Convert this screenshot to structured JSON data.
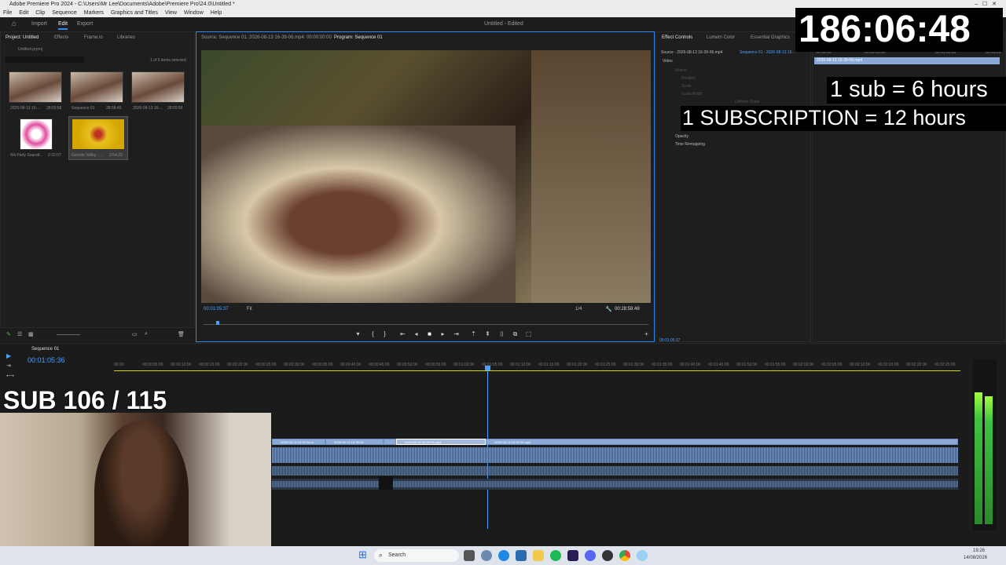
{
  "window": {
    "title": "Adobe Premiere Pro 2024 - C:\\Users\\Mr Lee\\Documents\\Adobe\\Premiere Pro\\24.0\\Untitled *"
  },
  "menu": [
    "File",
    "Edit",
    "Clip",
    "Sequence",
    "Markers",
    "Graphics and Titles",
    "View",
    "Window",
    "Help"
  ],
  "topnav": {
    "import": "Import",
    "edit": "Edit",
    "export": "Export",
    "project_name": "Untitled - Edited"
  },
  "project_panel": {
    "tabs": [
      "Project: Untitled",
      "Effects",
      "Frame.io",
      "Libraries"
    ],
    "file": "Untitled.prproj",
    "selection": "1 of 5 items selected",
    "items": [
      {
        "name": "2026-08-13 16-...",
        "duration": "28:59:58"
      },
      {
        "name": "Sequence 01",
        "duration": "28:58:49"
      },
      {
        "name": "2026-08-13 16-...",
        "duration": "28:59:58"
      },
      {
        "name": "Wii Party Soundt...",
        "duration": "2:32:07"
      },
      {
        "name": "Gerudo Valley - ...",
        "duration": "2:54:23"
      }
    ]
  },
  "monitor": {
    "source_tab": "Source: Sequence 01: 2026-08-13 16-39-06.mp4: 00:00:00:00",
    "program_tab": "Program: Sequence 01",
    "current_time": "00:01:05:37",
    "fit": "Fit",
    "quality": "1/4",
    "duration": "00:28:58:49"
  },
  "effect_controls": {
    "tabs": [
      "Effect Controls",
      "Lumetri Color",
      "Essential Graphics"
    ],
    "source": "Source - 2026-08-13 16-39-06.mp4",
    "sequence": "Sequence 01 - 2026-08-13 16-...",
    "video_label": "Video",
    "rows": [
      "Motion",
      "Position",
      "Scale",
      "Scale Width",
      "Uniform Scale",
      "Opacity",
      "Time Remapping"
    ],
    "mini_clip": "2026-08-13 16-39-06.mp4",
    "mini_times": [
      "00:50:00",
      "00:00:55:00",
      "00:01:00:00",
      "00:01:05"
    ],
    "footer_time": "00:01:05:37"
  },
  "timeline": {
    "tab": "Sequence 01",
    "timecode": "00:01:05:36",
    "ruler": [
      "00:00",
      "00:00:05:00",
      "00:00:10:00",
      "00:00:15:00",
      "00:00:20:00",
      "00:00:25:00",
      "00:00:30:00",
      "00:00:35:00",
      "00:00:40:00",
      "00:00:45:00",
      "00:00:50:00",
      "00:00:55:00",
      "00:01:00:00",
      "00:01:05:00",
      "00:01:10:00",
      "00:01:15:00",
      "00:01:20:00",
      "00:01:25:00",
      "00:01:30:00",
      "00:01:35:00",
      "00:01:40:00",
      "00:01:45:00",
      "00:01:50:00",
      "00:01:55:00",
      "00:02:00:00",
      "00:02:05:00",
      "00:02:10:00",
      "00:02:15:00",
      "00:02:20:00",
      "00:02:25:00"
    ],
    "clips": [
      "2026-08-13 16-39-06.m",
      "2026-08-13 16-39-06",
      "2026-08-13 16-39-06.mp4",
      "2026-08-13 16-39-06.mp4"
    ]
  },
  "overlay": {
    "timer": "186:06:48",
    "sub_rate": "1 sub = 6 hours",
    "subscription_rate": "1 SUBSCRIPTION = 12 hours",
    "sub_counter": "SUB 106 / 115"
  },
  "taskbar": {
    "search": "Search",
    "time": "19:26",
    "date": "14/08/2026"
  },
  "colors": {
    "accent": "#2d8ceb",
    "clip": "#8aa9d6",
    "playhead": "#4aa0ff",
    "meter": "#3fc23f"
  }
}
